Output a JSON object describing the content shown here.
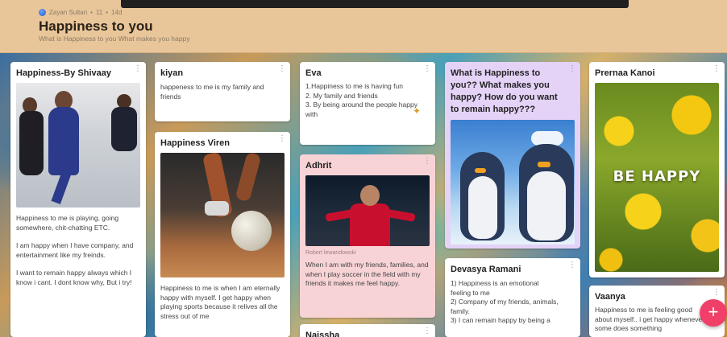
{
  "header": {
    "author": "Zayan Sultan",
    "meta_sep": "•",
    "likes": "11",
    "age": "14d",
    "title": "Happiness to you",
    "subtitle": "What is Happiness to you What makes you happy"
  },
  "cards": {
    "shivaay": {
      "title": "Happiness-By Shivaay",
      "p1": "Happiness to me is playing, going somewhere, chit-chatting ETC.",
      "p2": "I am happy when I have company, and entertainment like my freinds.",
      "p3": "I want to remain happy always which I know i cant. I dont know why, But i try!"
    },
    "kiyan": {
      "title": "kiyan",
      "body": "happeness to me is my family and friends"
    },
    "viren": {
      "title": "Happiness Viren",
      "body": "Happiness to me is when I am eternally happy with myself. I get happy when playing sports because it relives all the stress out of me"
    },
    "eva": {
      "title": "Eva",
      "l1": "1.Happiness to me is having fun",
      "l2": "2. My family and friends",
      "l3": "3. By being around the people happy with"
    },
    "adhrit": {
      "title": "Adhrit",
      "caption": "Robert lewandowski",
      "body": "When I am with my friends, families, and when I play soccer in the field with my friends it makes me feel happy."
    },
    "naissha": {
      "title": "Naissha"
    },
    "question": {
      "title": "What is Happiness to you?? What makes you happy? How do you want to remain happy???"
    },
    "devasya": {
      "title": "Devasya Ramani",
      "l1": "1) Happiness is an emotional feeling to me",
      "l2": "2) Company of my friends, animals, family.",
      "l3": "3) I can remain happy by being a"
    },
    "prernaa": {
      "title": "Prernaa Kanoi",
      "image_text": "BE HAPPY"
    },
    "vaanya": {
      "title": "Vaanya",
      "body": "Happiness to me is feeling good about myself.. i get happy whenever some does something"
    }
  },
  "fab": {
    "label": "+"
  },
  "colors": {
    "header": "#e9c69a",
    "accent": "#f0406a",
    "purple_card": "#e4d2f7",
    "pink_card": "#f8d3d6"
  }
}
